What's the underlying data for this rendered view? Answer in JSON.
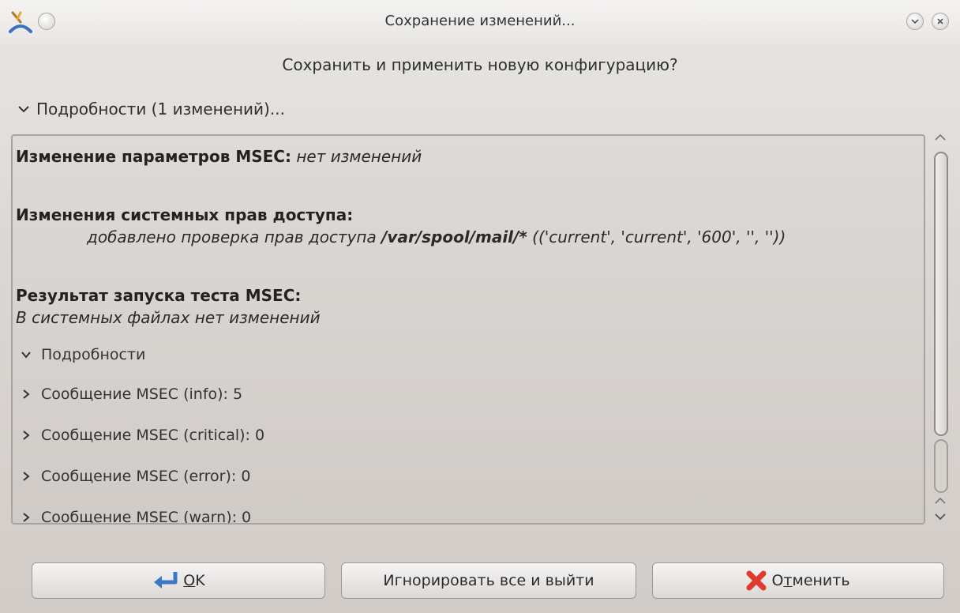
{
  "window": {
    "title": "Сохранение изменений..."
  },
  "dialog": {
    "question": "Сохранить и применить новую конфигурацию?",
    "details_toggle": "Подробности (1 изменений)..."
  },
  "panel": {
    "msec_changes_title": "Изменение параметров MSEC:",
    "msec_changes_value": "нет изменений",
    "perm_changes_title": "Изменения системных прав доступа:",
    "perm_line_prefix": "добавлено проверка прав доступа",
    "perm_line_path": "/var/spool/mail/*",
    "perm_line_suffix": "(('current', 'current', '600', '', ''))",
    "test_title": "Результат запуска теста MSEC:",
    "test_value": "В системных файлах нет изменений",
    "tree": [
      {
        "label": "Подробности",
        "expanded": true
      },
      {
        "label": "Сообщение MSEC (info): 5",
        "expanded": false
      },
      {
        "label": "Сообщение MSEC (critical): 0",
        "expanded": false
      },
      {
        "label": "Сообщение MSEC (error): 0",
        "expanded": false
      },
      {
        "label": "Сообщение MSEC (warn): 0",
        "expanded": false
      }
    ]
  },
  "buttons": {
    "ok": {
      "mnemonic": "O",
      "rest": "K"
    },
    "ignore": "Игнорировать все и выйти",
    "cancel": {
      "prefix": "О",
      "mnemonic": "т",
      "rest": "менить"
    }
  },
  "colors": {
    "cancel_icon": "#e03a2c",
    "ok_icon": "#3b78c8"
  }
}
